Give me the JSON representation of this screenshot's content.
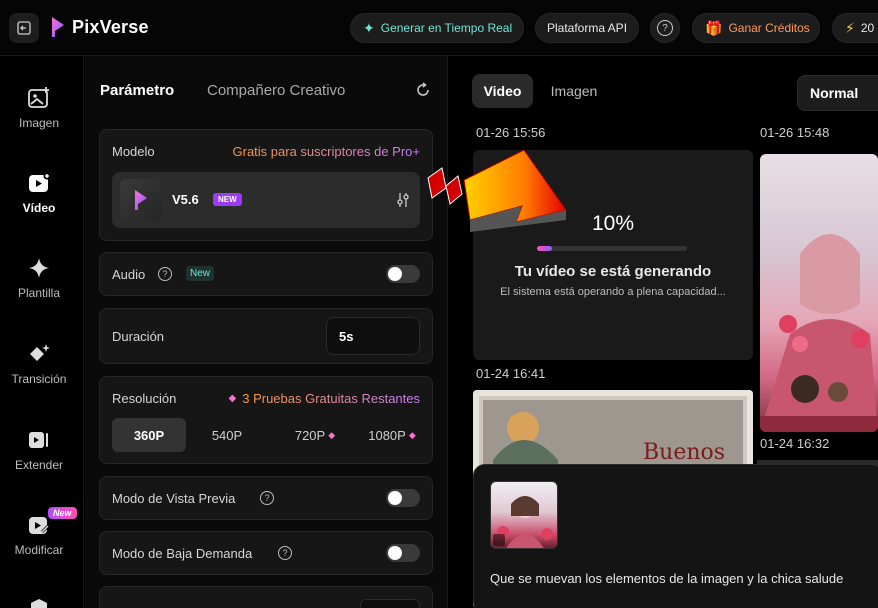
{
  "app": {
    "brand": "PixVerse"
  },
  "header": {
    "realtime_label": "Generar en Tiempo Real",
    "api_label": "Plataforma API",
    "help_symbol": "?",
    "credits_label": "Ganar Créditos",
    "bolt_value": "20"
  },
  "leftnav": {
    "items": [
      {
        "label": "Imagen",
        "icon": "image-plus-icon"
      },
      {
        "label": "Vídeo",
        "icon": "video-plus-icon",
        "active": true
      },
      {
        "label": "Plantilla",
        "icon": "sparkle-icon"
      },
      {
        "label": "Transición",
        "icon": "diamond-sparkle-icon"
      },
      {
        "label": "Extender",
        "icon": "extend-icon"
      },
      {
        "label": "Modificar",
        "icon": "modify-icon",
        "badge": "New"
      }
    ]
  },
  "panel": {
    "tab_param": "Parámetro",
    "tab_companion": "Compañero Creativo",
    "model": {
      "label": "Modelo",
      "promo": "Gratis para suscriptores de Pro+",
      "name": "V5.6",
      "badge": "NEW"
    },
    "audio": {
      "label": "Audio",
      "badge": "New"
    },
    "duration": {
      "label": "Duración",
      "value": "5s"
    },
    "resolution": {
      "label": "Resolución",
      "trials": "3 Pruebas Gratuitas Restantes",
      "options": [
        "360P",
        "540P",
        "720P",
        "1080P"
      ],
      "selected": "360P"
    },
    "preview_mode": {
      "label": "Modo de Vista Previa"
    },
    "low_demand_mode": {
      "label": "Modo de Baja Demanda"
    }
  },
  "feed": {
    "tab_video": "Video",
    "tab_image": "Imagen",
    "quality": "Normal",
    "timestamps": [
      "01-26 15:56",
      "01-26 15:48",
      "01-24 16:41",
      "01-24 16:32"
    ],
    "generating": {
      "percent": "10%",
      "progress": 0.1,
      "title": "Tu vídeo se está generando",
      "subtitle": "El sistema está operando a plena capacidad..."
    },
    "card_overlay_text": "Buenos"
  },
  "popup": {
    "prompt": "Que se muevan los elementos de la imagen y la chica salude"
  },
  "colors": {
    "accent_teal": "#6fe6d6",
    "accent_orange": "#ff9a5c",
    "promo_gradient_start": "#ff9a3c",
    "promo_gradient_end": "#c77dff",
    "badge_purple": "#9a3df0"
  }
}
